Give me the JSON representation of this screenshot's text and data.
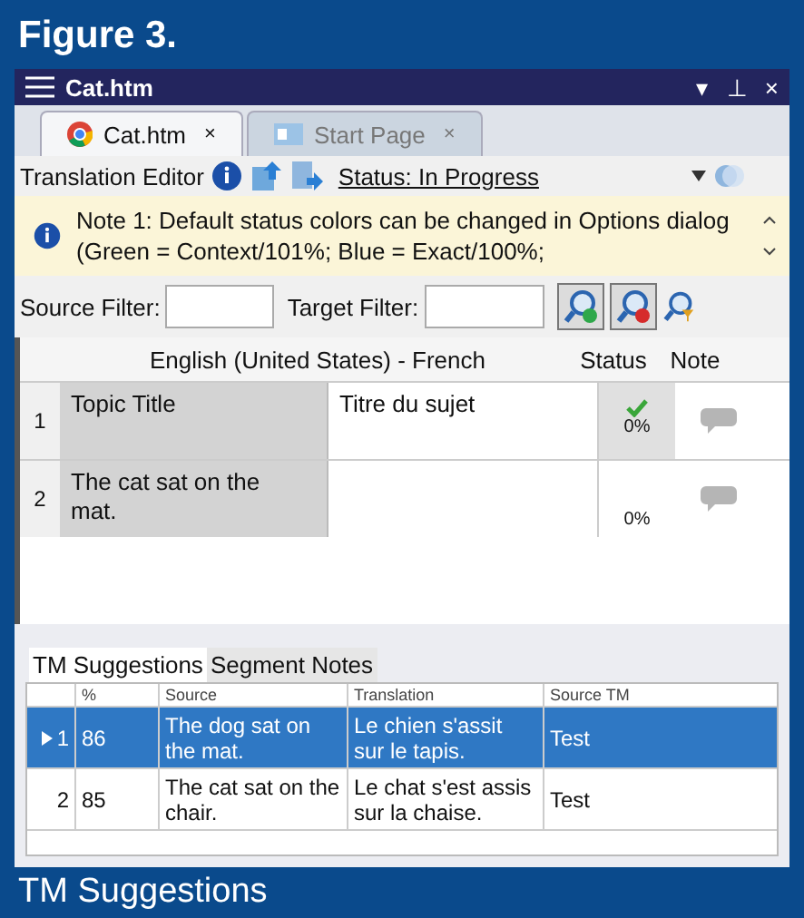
{
  "figure_title": "Figure 3.",
  "window": {
    "title": "Cat.htm",
    "controls": [
      "▾",
      "⊥",
      "×"
    ]
  },
  "tabs": [
    {
      "label": "Cat.htm",
      "close": "×",
      "selected": true,
      "kind": "browser"
    },
    {
      "label": "Start Page",
      "close": "×",
      "selected": false,
      "kind": "page"
    }
  ],
  "toolbar": {
    "label": "Translation Editor",
    "status": "Status: In Progress"
  },
  "note": {
    "text": "Note 1: Default status colors can be changed in Options dialog (Green = Context/101%; Blue = Exact/100%;"
  },
  "filters": {
    "source_label": "Source Filter:",
    "target_label": "Target Filter:"
  },
  "grid": {
    "header": "English (United States) - French",
    "status_header": "Status",
    "note_header": "Note",
    "rows": [
      {
        "number": "1",
        "source": "Topic Title",
        "target": "Titre du sujet",
        "status": "0%",
        "confirmed": true
      },
      {
        "number": "2",
        "source": "The cat sat on the mat.",
        "status": "0%",
        "confirmed": false
      }
    ]
  },
  "bottom_tabs": [
    {
      "label": "TM Suggestions",
      "selected": true
    },
    {
      "label": "Segment Notes",
      "selected": false
    }
  ],
  "tm": {
    "columns": [
      "%",
      "Source",
      "Translation",
      "Source TM"
    ],
    "rows": [
      {
        "number": "1",
        "percent": "86",
        "source": "The dog sat on the mat.",
        "translation": "Le chien s'assit sur le tapis.",
        "source_tm": "Test",
        "selected": true
      },
      {
        "number": "2",
        "percent": "85",
        "source": "The cat sat on the chair.",
        "translation": "Le chat s'est assis sur la chaise.",
        "source_tm": "Test",
        "selected": false
      }
    ]
  },
  "caption": "TM Suggestions"
}
